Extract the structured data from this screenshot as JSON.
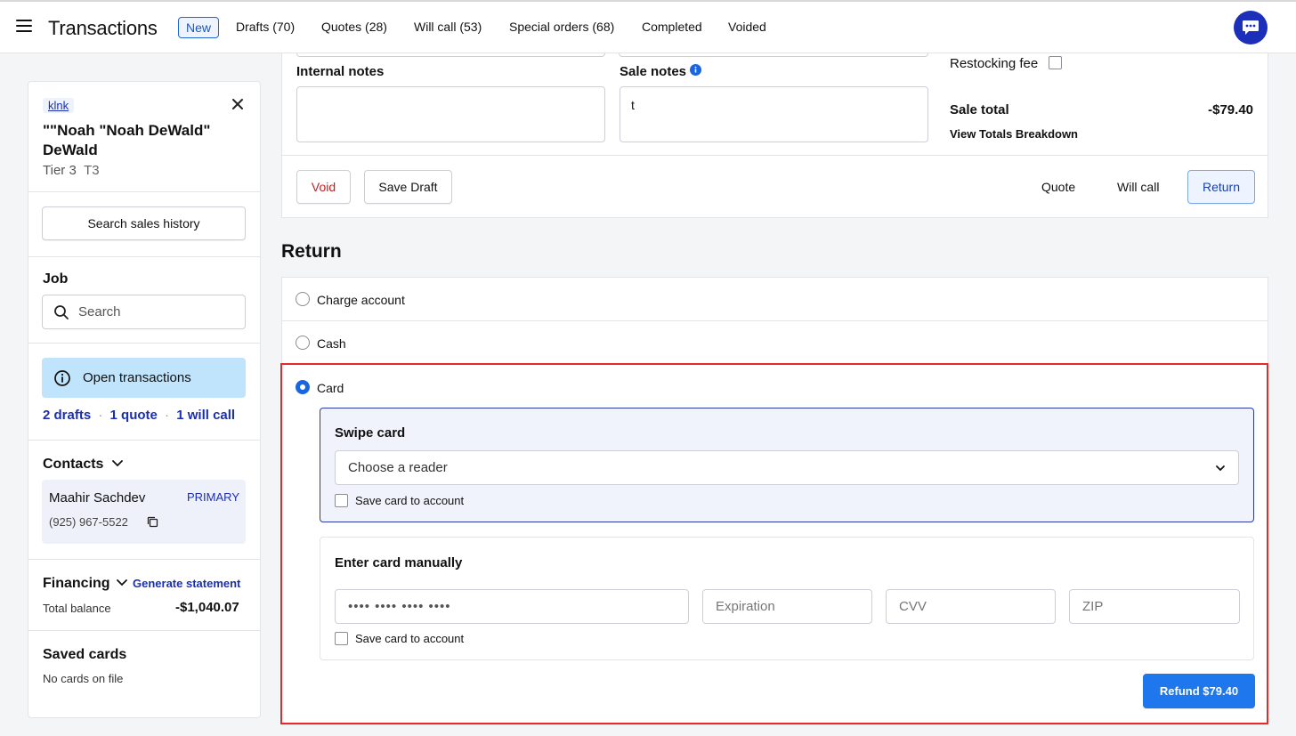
{
  "header": {
    "title": "Transactions",
    "tabs": [
      "New",
      "Drafts (70)",
      "Quotes (28)",
      "Will call (53)",
      "Special orders (68)",
      "Completed",
      "Voided"
    ]
  },
  "customer": {
    "tag": "klnk",
    "name_line1": "\"\"Noah \"Noah DeWald\"",
    "name_line2": "DeWald",
    "tier": "Tier 3",
    "tier_code": "T3",
    "search_history": "Search sales history"
  },
  "job": {
    "heading": "Job",
    "search_placeholder": "Search"
  },
  "open_transactions": {
    "label": "Open transactions",
    "drafts": "2 drafts",
    "quote": "1 quote",
    "will_call": "1 will call",
    "sep": "·"
  },
  "contacts": {
    "heading": "Contacts",
    "name": "Maahir Sachdev",
    "badge": "PRIMARY",
    "phone": "(925) 967-5522"
  },
  "financing": {
    "heading": "Financing",
    "generate": "Generate statement",
    "balance_label": "Total balance",
    "balance_value": "-$1,040.07"
  },
  "saved_cards": {
    "heading": "Saved cards",
    "empty": "No cards on file"
  },
  "notes": {
    "internal_label": "Internal notes",
    "sale_label": "Sale notes",
    "sale_value": "t"
  },
  "totals": {
    "restocking_label": "Restocking fee",
    "sale_total_label": "Sale total",
    "sale_total_value": "-$79.40",
    "breakdown_link": "View Totals Breakdown"
  },
  "actions": {
    "void": "Void",
    "save_draft": "Save Draft",
    "quote": "Quote",
    "will_call": "Will call",
    "return": "Return"
  },
  "return": {
    "heading": "Return",
    "options": [
      "Charge account",
      "Cash",
      "Card"
    ],
    "swipe_heading": "Swipe card",
    "reader_placeholder": "Choose a reader",
    "save_card": "Save card to account",
    "manual_heading": "Enter card manually",
    "card_number_placeholder": "•••• •••• •••• ••••",
    "expiration_placeholder": "Expiration",
    "cvv_placeholder": "CVV",
    "zip_placeholder": "ZIP",
    "refund_button": "Refund $79.40"
  },
  "colors": {
    "accent": "#1a66e0",
    "link": "#1b2fb0",
    "void_red": "#c81e1e",
    "highlight_border": "#e52a2a",
    "info_bg": "#bfe4fb"
  }
}
